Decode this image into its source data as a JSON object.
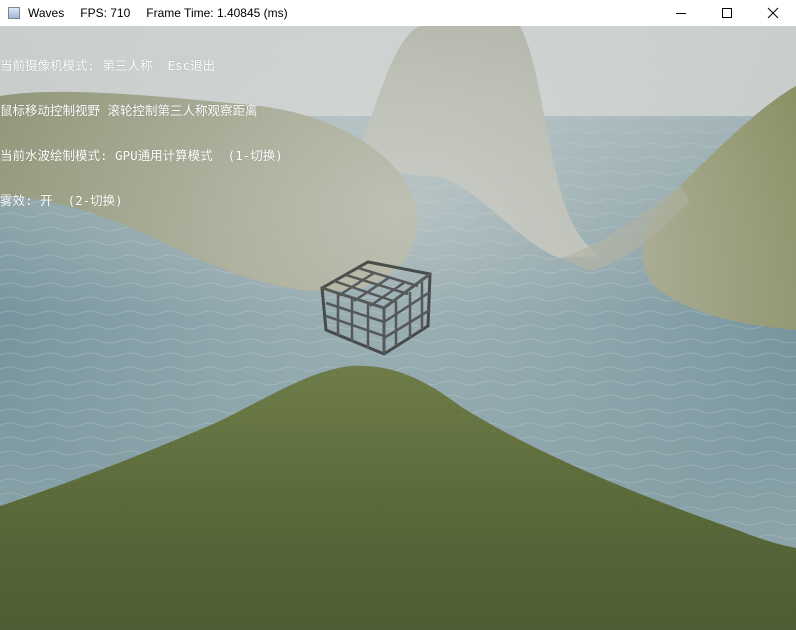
{
  "window": {
    "title": "Waves",
    "fps_text": "FPS: 710",
    "frame_time_text": "Frame Time: 1.40845 (ms)"
  },
  "hud": {
    "line1": "当前摄像机模式: 第三人称  Esc退出",
    "line2": "鼠标移动控制视野 滚轮控制第三人称观察距离",
    "line3": "当前水波绘制模式: GPU通用计算模式  (1-切换)",
    "line4": "雾效: 开  (2-切换)"
  },
  "colors": {
    "water": "#6f8f98",
    "fog": "#c8cdc9",
    "grass_near": "#5b6b3c",
    "grass_far": "#8e9478",
    "hud_text": "#ffffff"
  },
  "icons": {
    "minimize": "minimize-icon",
    "maximize": "maximize-icon",
    "close": "close-icon",
    "app": "app-icon"
  }
}
